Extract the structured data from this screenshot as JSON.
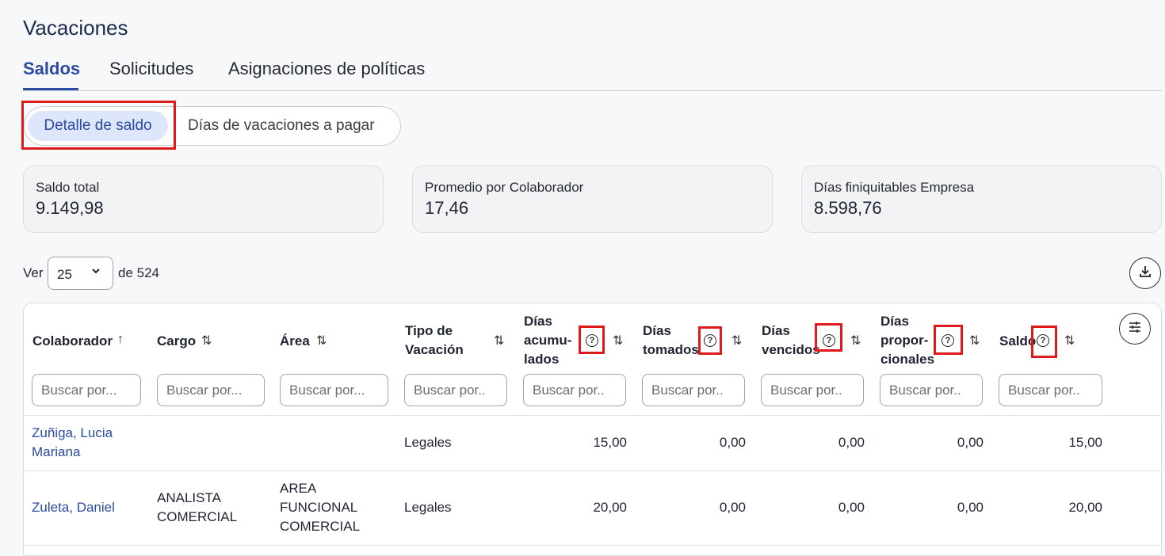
{
  "page": {
    "title": "Vacaciones"
  },
  "tabs": [
    {
      "label": "Saldos",
      "active": true
    },
    {
      "label": "Solicitudes"
    },
    {
      "label": "Asignaciones de políticas"
    }
  ],
  "segments": {
    "active": "Detalle de saldo",
    "inactive": "Días de vacaciones a pagar"
  },
  "summary": [
    {
      "label": "Saldo total",
      "value": "9.149,98"
    },
    {
      "label": "Promedio por Colaborador",
      "value": "17,46"
    },
    {
      "label": "Días finiquitables Empresa",
      "value": "8.598,76"
    }
  ],
  "paging": {
    "ver_label": "Ver",
    "page_size": "25",
    "of_label": "de 524"
  },
  "columns": {
    "colaborador": "Colaborador",
    "cargo": "Cargo",
    "area": "Área",
    "tipo_l1": "Tipo de",
    "tipo_l2": "Vacación",
    "acum_l1": "Días",
    "acum_l2": "acumu-",
    "acum_l3": "lados",
    "tom_l1": "Días",
    "tom_l2": "tomados",
    "venc_l1": "Días",
    "venc_l2": "vencidos",
    "prop_l1": "Días",
    "prop_l2": "propor-",
    "prop_l3": "cionales",
    "saldo": "Saldo"
  },
  "filters": {
    "wide_placeholder": "Buscar por...",
    "narrow_placeholder": "Buscar por.."
  },
  "rows": [
    {
      "colaborador_l1": "Zuñiga, Lucia",
      "colaborador_l2": "Mariana",
      "tipo": "Legales",
      "acumulados": "15,00",
      "tomados": "0,00",
      "vencidos": "0,00",
      "proporcionales": "0,00",
      "saldo": "15,00"
    },
    {
      "colaborador": "Zuleta, Daniel",
      "cargo_l1": "ANALISTA",
      "cargo_l2": "COMERCIAL",
      "area_l1": "AREA",
      "area_l2": "FUNCIONAL",
      "area_l3": "COMERCIAL",
      "tipo": "Legales",
      "acumulados": "20,00",
      "tomados": "0,00",
      "vencidos": "0,00",
      "proporcionales": "0,00",
      "saldo": "20,00"
    }
  ],
  "icons": {
    "chevron": "chevron-down-icon",
    "download": "download-icon",
    "columns": "column-settings-icon",
    "help": "help-icon",
    "sort": "sort-icon"
  },
  "colors": {
    "accent": "#2b4ba0",
    "highlight": "#e0191b",
    "active_segment_bg": "#dde6fa"
  }
}
